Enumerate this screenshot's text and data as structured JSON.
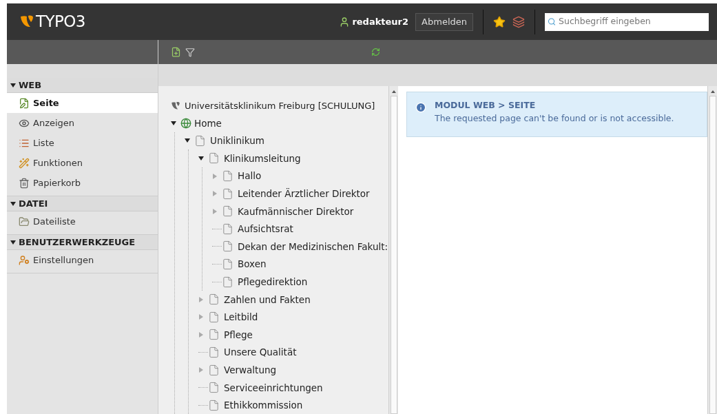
{
  "header": {
    "logo_text": "TYPO3",
    "username": "redakteur2",
    "logout_button": "Abmelden",
    "search": {
      "placeholder": "Suchbegriff eingeben"
    }
  },
  "module_menu": [
    {
      "title": "WEB",
      "expanded": true,
      "items": [
        {
          "label": "Seite",
          "kind": "page",
          "selected": true
        },
        {
          "label": "Anzeigen",
          "kind": "view",
          "selected": false
        },
        {
          "label": "Liste",
          "kind": "list",
          "selected": false
        },
        {
          "label": "Funktionen",
          "kind": "functions",
          "selected": false
        },
        {
          "label": "Papierkorb",
          "kind": "recycler",
          "selected": false
        }
      ]
    },
    {
      "title": "DATEI",
      "expanded": true,
      "items": [
        {
          "label": "Dateiliste",
          "kind": "filelist",
          "selected": false
        }
      ]
    },
    {
      "title": "BENUTZERWERKZEUGE",
      "expanded": true,
      "items": [
        {
          "label": "Einstellungen",
          "kind": "settings",
          "selected": false
        }
      ]
    }
  ],
  "page_tree": {
    "root": {
      "label": "Universitätsklinikum Freiburg [SCHULUNG]",
      "kind": "root"
    },
    "children": [
      {
        "label": "Home",
        "kind": "home",
        "expandable": true,
        "expanded": true,
        "children": [
          {
            "label": "Uniklinikum",
            "kind": "page",
            "expandable": true,
            "expanded": true,
            "children": [
              {
                "label": "Klinikumsleitung",
                "kind": "page",
                "expandable": true,
                "expanded": true,
                "children": [
                  {
                    "label": "Hallo",
                    "kind": "page",
                    "expandable": true,
                    "expanded": false
                  },
                  {
                    "label": "Leitender Ärztlicher Direktor",
                    "kind": "page",
                    "expandable": true,
                    "expanded": false
                  },
                  {
                    "label": "Kaufmännischer Direktor",
                    "kind": "page",
                    "expandable": true,
                    "expanded": false
                  },
                  {
                    "label": "Aufsichtsrat",
                    "kind": "page",
                    "expandable": false
                  },
                  {
                    "label": "Dekan der Medizinischen Fakult:",
                    "kind": "page",
                    "expandable": false
                  },
                  {
                    "label": "Boxen",
                    "kind": "page",
                    "expandable": false
                  },
                  {
                    "label": "Pflegedirektion",
                    "kind": "page",
                    "expandable": false
                  }
                ]
              },
              {
                "label": "Zahlen und Fakten",
                "kind": "page",
                "expandable": true,
                "expanded": false
              },
              {
                "label": "Leitbild",
                "kind": "page",
                "expandable": true,
                "expanded": false
              },
              {
                "label": "Pflege",
                "kind": "page",
                "expandable": true,
                "expanded": false
              },
              {
                "label": "Unsere Qualität",
                "kind": "page",
                "expandable": false
              },
              {
                "label": "Verwaltung",
                "kind": "page",
                "expandable": true,
                "expanded": false
              },
              {
                "label": "Serviceeinrichtungen",
                "kind": "page",
                "expandable": false
              },
              {
                "label": "Ethikkommission",
                "kind": "page",
                "expandable": false
              }
            ]
          }
        ]
      }
    ]
  },
  "message": {
    "kind": "info",
    "title": "MODUL WEB > SEITE",
    "text": "The requested page can't be found or is not accessible."
  }
}
